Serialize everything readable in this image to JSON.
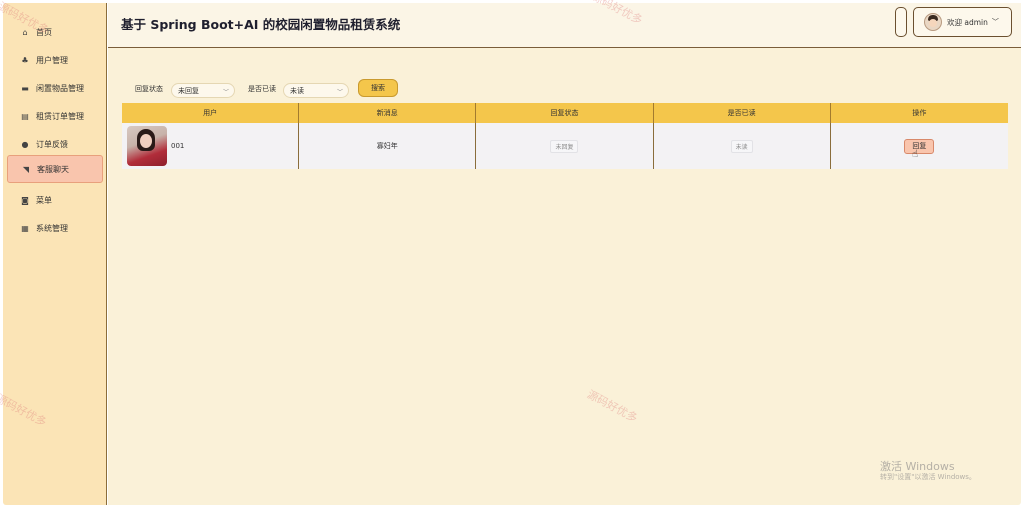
{
  "app_title": "基于 Spring Boot+AI 的校园闲置物品租赁系统",
  "sidebar": {
    "items": [
      {
        "label": "首页",
        "icon": "home-icon",
        "glyph": "⌂",
        "active": false
      },
      {
        "label": "用户管理",
        "icon": "users-icon",
        "glyph": "♣",
        "active": false
      },
      {
        "label": "闲置物品管理",
        "icon": "box-icon",
        "glyph": "▬",
        "active": false
      },
      {
        "label": "租赁订单管理",
        "icon": "order-icon",
        "glyph": "▤",
        "active": false
      },
      {
        "label": "订单反馈",
        "icon": "feedback-icon",
        "glyph": "●",
        "active": false
      },
      {
        "label": "客服聊天",
        "icon": "chat-icon",
        "glyph": "◥",
        "active": true
      },
      {
        "label": "菜单",
        "icon": "menu-icon",
        "glyph": "◙",
        "active": false
      },
      {
        "label": "系统管理",
        "icon": "grid-icon",
        "glyph": "▦",
        "active": false
      }
    ]
  },
  "header": {
    "user_label": "欢迎 admin",
    "user_chevron": "﹀"
  },
  "filters": {
    "reply_status_label": "回复状态",
    "reply_status_value": "未回复",
    "read_label": "是否已读",
    "read_value": "未读",
    "search_label": "搜索",
    "chevron": "﹀"
  },
  "table": {
    "headers": [
      "用户",
      "新消息",
      "回复状态",
      "是否已读",
      "操作"
    ],
    "rows": [
      {
        "user": "001",
        "message": "寡妇年",
        "reply_status": "未回复",
        "read": "未读",
        "action": "回复"
      }
    ]
  },
  "watermark": "源码好优多",
  "windows_activation": {
    "title": "激活 Windows",
    "subtitle": "转到\"设置\"以激活 Windows。"
  },
  "colors": {
    "sidebar_bg": "#fbe4b6",
    "main_bg": "#faf1d8",
    "accent": "#f4c64b",
    "active_item": "#f9c5ad"
  }
}
